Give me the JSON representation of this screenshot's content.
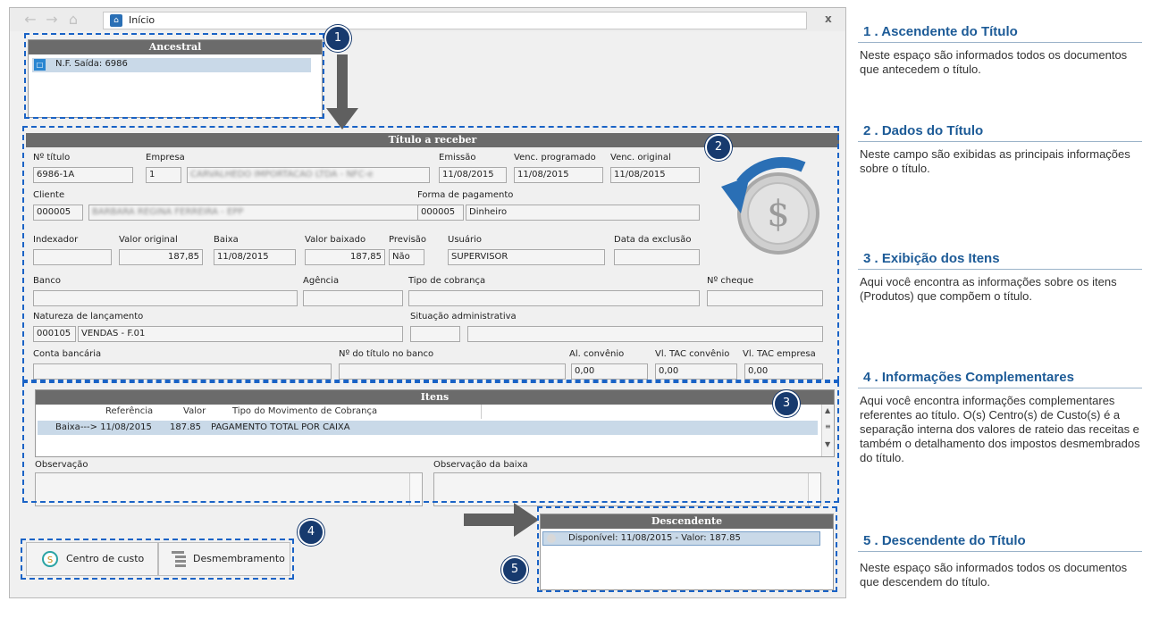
{
  "window": {
    "tab_title": "Início",
    "close_label": "x"
  },
  "ancestral": {
    "header": "Ancestral",
    "items": [
      "N.F. Saída: 6986"
    ]
  },
  "titulo": {
    "header": "Título a receber",
    "labels": {
      "numero": "Nº título",
      "empresa": "Empresa",
      "emissao": "Emissão",
      "venc_programado": "Venc. programado",
      "venc_original": "Venc. original",
      "cliente": "Cliente",
      "forma_pagamento": "Forma de pagamento",
      "indexador": "Indexador",
      "valor_original": "Valor original",
      "baixa": "Baixa",
      "valor_baixado": "Valor baixado",
      "previsao": "Previsão",
      "usuario": "Usuário",
      "data_exclusao": "Data da exclusão",
      "banco": "Banco",
      "agencia": "Agência",
      "tipo_cobranca": "Tipo de cobrança",
      "no_cheque": "Nº cheque",
      "natureza": "Natureza de lançamento",
      "situacao": "Situação administrativa",
      "conta_bancaria": "Conta bancária",
      "no_titulo_banco": "Nº do título no banco",
      "al_convenio": "Al. convênio",
      "vl_tac_convenio": "Vl. TAC convênio",
      "vl_tac_empresa": "Vl. TAC empresa"
    },
    "values": {
      "numero": "6986-1A",
      "empresa_codigo": "1",
      "empresa_nome": "CARVALHEDO IMPORTACAO LTDA - NFC-e",
      "emissao": "11/08/2015",
      "venc_programado": "11/08/2015",
      "venc_original": "11/08/2015",
      "cliente_codigo": "000005",
      "cliente_nome": "BARBARA REGINA FERREIRA - EPP",
      "forma_codigo": "000005",
      "forma_nome": "Dinheiro",
      "indexador": "",
      "valor_original": "187,85",
      "baixa": "11/08/2015",
      "valor_baixado": "187,85",
      "previsao": "Não",
      "usuario": "SUPERVISOR",
      "data_exclusao": "",
      "natureza_codigo": "000105",
      "natureza_nome": "VENDAS - F.01",
      "al_convenio": "0,00",
      "vl_tac_convenio": "0,00",
      "vl_tac_empresa": "0,00"
    }
  },
  "itens": {
    "header": "Itens",
    "columns": [
      "Referência",
      "Valor",
      "Tipo do Movimento de Cobrança"
    ],
    "rows": [
      {
        "referencia": "Baixa---> 11/08/2015",
        "valor": "187.85",
        "tipo": "PAGAMENTO TOTAL POR CAIXA"
      }
    ],
    "observacao_label": "Observação",
    "observacao_baixa_label": "Observação da baixa"
  },
  "descendente": {
    "header": "Descendente",
    "items": [
      "Disponível: 11/08/2015 - Valor: 187.85"
    ]
  },
  "buttons": {
    "centro_custo": "Centro de custo",
    "desmembramento": "Desmembramento"
  },
  "badges": [
    "1",
    "2",
    "3",
    "4",
    "5"
  ],
  "sections": [
    {
      "title": "1 . Ascendente do Título",
      "text": "Neste espaço são informados todos os documentos que antecedem o título."
    },
    {
      "title": "2 . Dados do Título",
      "text": "Neste campo são exibidas as principais informações sobre o título."
    },
    {
      "title": "3 . Exibição dos Itens",
      "text": "Aqui você encontra as informações sobre os itens (Produtos) que compõem o título."
    },
    {
      "title": "4 . Informações Complementares",
      "text": "Aqui você encontra informações complementares referentes ao título. O(s) Centro(s) de Custo(s) é a separação interna dos valores de rateio das receitas e também o detalhamento dos impostos desmembrados do título."
    },
    {
      "title": "5 . Descendente do Título",
      "text": "Neste espaço são informados todos os documentos que descendem do título."
    }
  ],
  "colors": {
    "accent_blue": "#1d5b97",
    "badge_navy": "#173a6e",
    "dash_blue": "#1a63c6",
    "panel_header": "#6b6b6b",
    "selection": "#c9d9e8"
  }
}
